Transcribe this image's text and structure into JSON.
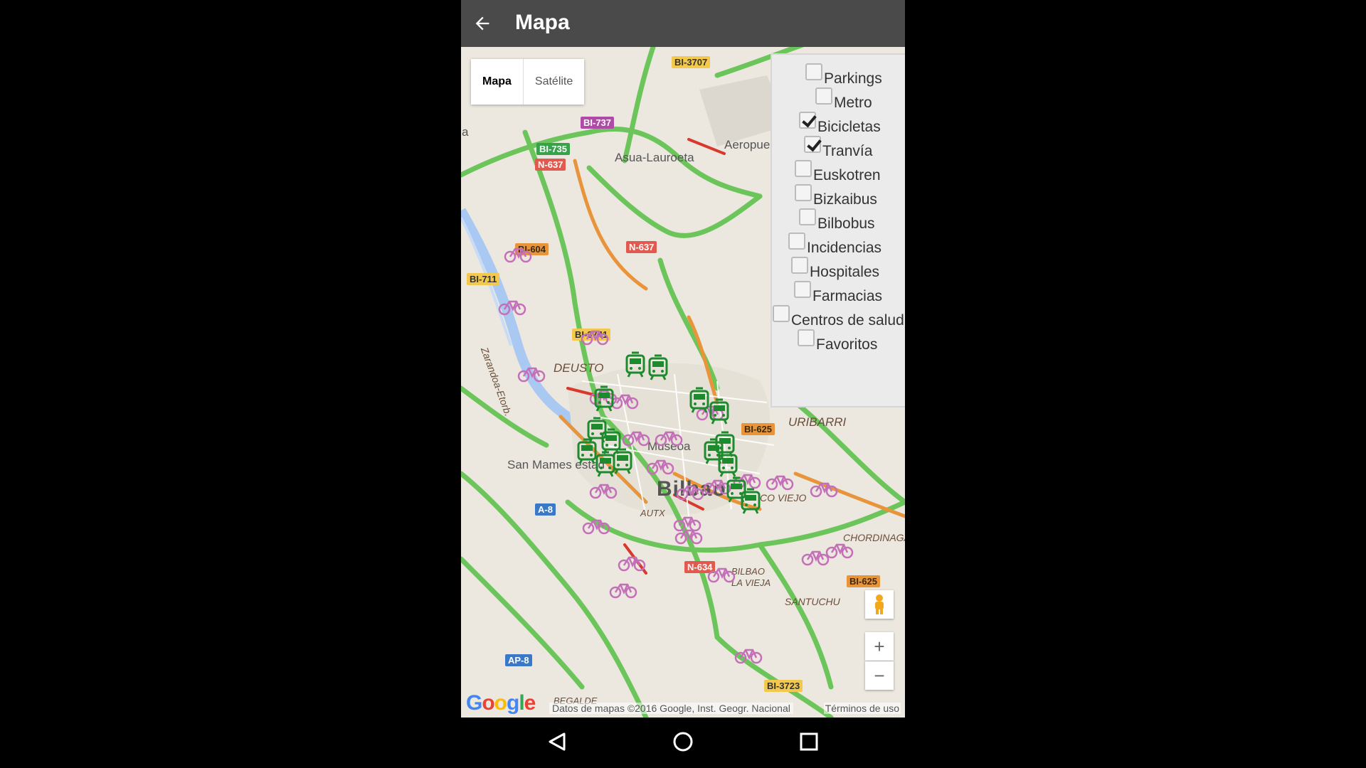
{
  "app": {
    "title": "Mapa",
    "back_icon": "arrow-left-icon"
  },
  "maptype": {
    "options": [
      "Mapa",
      "Satélite"
    ],
    "selected": "Mapa"
  },
  "layers": [
    {
      "label": "Parkings",
      "checked": false
    },
    {
      "label": "Metro",
      "checked": false
    },
    {
      "label": "Bicicletas",
      "checked": true
    },
    {
      "label": "Tranvía",
      "checked": true
    },
    {
      "label": "Euskotren",
      "checked": false
    },
    {
      "label": "Bizkaibus",
      "checked": false
    },
    {
      "label": "Bilbobus",
      "checked": false
    },
    {
      "label": "Incidencias",
      "checked": false
    },
    {
      "label": "Hospitales",
      "checked": false
    },
    {
      "label": "Farmacias",
      "checked": false
    },
    {
      "label": "Centros de salud",
      "checked": false
    },
    {
      "label": "Favoritos",
      "checked": false
    }
  ],
  "map_labels": {
    "road_signs": [
      "BI-3707",
      "BI-737",
      "BI-735",
      "N-637",
      "N-637",
      "BI-604",
      "BI-711",
      "BI-3741",
      "BI-625",
      "A-8",
      "N-634",
      "BI-625",
      "AP-8",
      "BI-3723"
    ],
    "places": [
      "Asua-Lauroeta",
      "Aeropue",
      "DEUSTO",
      "URIBARRI",
      "Museoa",
      "San Mames estad",
      "Bilbao",
      "CO VIEJO",
      "CHORDINAGA",
      "BILBAO LA VIEJA",
      "SANTUCHU",
      "Zarandoa-Etorb.",
      "AUTX",
      "a",
      "BEGALDE"
    ]
  },
  "controls": {
    "zoom_in": "+",
    "zoom_out": "−",
    "pegman_icon": "pegman-icon"
  },
  "footer": {
    "logo": "Google",
    "attribution": "Datos de mapas ©2016 Google, Inst. Geogr. Nacional",
    "terms": "Términos de uso"
  },
  "navbar": {
    "back": "nav-back-icon",
    "home": "nav-home-icon",
    "recents": "nav-recents-icon"
  },
  "colors": {
    "appbar": "#4a4a4a",
    "bike_marker": "#c470b8",
    "tram_marker": "#1e8a2e",
    "traffic_green": "#6cc55a",
    "water": "#a9c8f2"
  }
}
